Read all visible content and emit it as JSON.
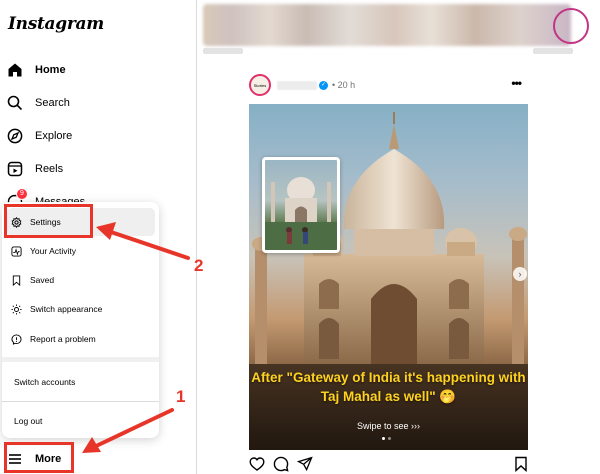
{
  "app": {
    "logo": "Instagram"
  },
  "sidebar": {
    "items": [
      {
        "label": "Home",
        "icon": "home-icon"
      },
      {
        "label": "Search",
        "icon": "search-icon"
      },
      {
        "label": "Explore",
        "icon": "compass-icon"
      },
      {
        "label": "Reels",
        "icon": "reels-icon"
      },
      {
        "label": "Messages",
        "icon": "messenger-icon",
        "badge": "9"
      }
    ],
    "more_label": "More"
  },
  "menu": {
    "items": [
      {
        "label": "Settings",
        "icon": "gear-icon"
      },
      {
        "label": "Your Activity",
        "icon": "activity-icon"
      },
      {
        "label": "Saved",
        "icon": "bookmark-icon"
      },
      {
        "label": "Switch appearance",
        "icon": "sun-icon"
      },
      {
        "label": "Report a problem",
        "icon": "report-icon"
      }
    ],
    "switch_accounts": "Switch accounts",
    "log_out": "Log out"
  },
  "post": {
    "time": "20 h",
    "caption": "After \"Gateway of India it's happening with Taj Mahal as well\" 🤭",
    "swipe": "Swipe to see ›››",
    "avatar_text": "Stories"
  },
  "annotations": {
    "one": "1",
    "two": "2",
    "color": "#e8352a"
  },
  "colors": {
    "badge": "#ff3040",
    "verified": "#0095f6",
    "caption": "#ffd21f"
  }
}
